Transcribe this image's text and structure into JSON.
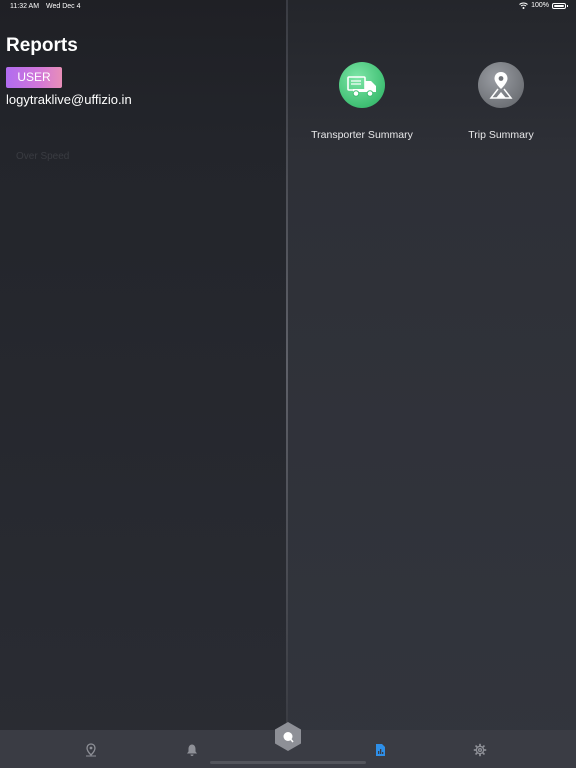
{
  "status_bar": {
    "time": "11:32 AM",
    "date": "Wed Dec 4",
    "battery": "100%"
  },
  "left_panel": {
    "title": "Reports",
    "role_badge": "USER",
    "email": "logytraklive@uffizio.in",
    "faint_text": "Over Speed"
  },
  "reports": [
    {
      "label": "Transporter Summary",
      "icon": "truck-icon",
      "color": "#4cc97f"
    },
    {
      "label": "Trip Summary",
      "icon": "map-pin-road-icon",
      "color": "#707378"
    }
  ],
  "tab_bar": {
    "tabs": [
      {
        "name": "map",
        "icon": "map-pin-icon",
        "active": false
      },
      {
        "name": "alerts",
        "icon": "bell-icon",
        "active": false
      },
      {
        "name": "dashboard",
        "icon": "hexagon-icon",
        "active": false
      },
      {
        "name": "reports",
        "icon": "report-doc-icon",
        "active": true
      },
      {
        "name": "settings",
        "icon": "gear-icon",
        "active": false
      }
    ],
    "active_color": "#2e8fe8",
    "inactive_color": "#8e9097"
  }
}
